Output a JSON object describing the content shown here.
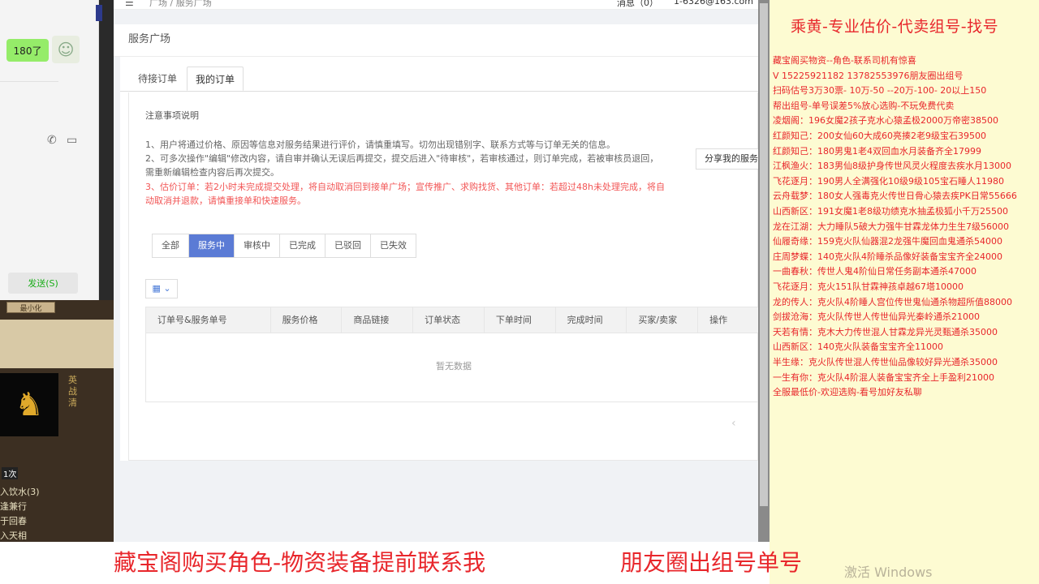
{
  "chat": {
    "bubble_text": "180了",
    "send_label": "发送(S)",
    "sticker_icon": "cat-sticker-icon",
    "phone_icon": "phone-icon",
    "video_icon": "video-icon"
  },
  "game": {
    "top_button": "最小化",
    "count": "1次",
    "lines": [
      "入饮水(3)",
      "逢兼行",
      "于回春",
      "入天相"
    ]
  },
  "web": {
    "breadcrumb": "广场 / 服务广场",
    "messages": "消息（0）",
    "email": "1-6326@163.com",
    "heading": "服务广场",
    "tabs": [
      "待接订单",
      "我的订单"
    ],
    "notice_title": "注意事项说明",
    "notices": [
      "1、用户将通过价格、原因等信息对服务结果进行评价，请慎重填写。切勿出现错别字、联系方式等与订单无关的信息。",
      "2、可多次操作\"编辑\"修改内容，请自审并确认无误后再提交，提交后进入\"待审核\"，若审核通过，则订单完成，若被审核员退回，需重新编辑检查内容后再次提交。"
    ],
    "red_notice": "3、估价订单：若2小时未完成提交处理，将自动取消回到接单广场；宣传推广、求购找货、其他订单：若超过48h未处理完成，将自动取消并退款，请慎重接单和快速服务。",
    "share_button": "分享我的服务",
    "filters": [
      "全部",
      "服务中",
      "审核中",
      "已完成",
      "已驳回",
      "已失效"
    ],
    "columns": [
      "订单号&服务单号",
      "服务价格",
      "商品链接",
      "订单状态",
      "下单时间",
      "完成时间",
      "买家/卖家",
      "操作"
    ],
    "empty": "暂无数据"
  },
  "ads": {
    "title": "乘黄-专业估价-代卖组号-找号",
    "rows": [
      "藏宝阁买物资--角色-联系司机有惊喜",
      "V 15225921182  13782553976朋友圈出组号",
      "扫码估号3万30票- 10万-50 --20万-100- 20以上150",
      "帮出组号-单号误差5%放心选购-不玩免费代卖",
      "凌烟阁：196女魔2孩子克水心猿孟极2000万帝密38500",
      "红颜知己：200女仙60大成60亮揍2老9级宝石39500",
      "红颜知己：180男鬼1老4双回血水月装备齐全17999",
      "江枫渔火：183男仙8级护身传世风灵火程度去疾水月13000",
      "飞花逐月：190男人全满强化10级9级105宝石睡人11980",
      "云舟载梦：180女人强毒克火传世日骨心猿去疾PK日常55666",
      "山西新区：191女魔1老8级功绩克水抽孟极狐小千万25500",
      "龙在江湖：大力睡队5破大力强牛甘霖龙体力生生7级56000",
      "仙履奇缘：159克火队仙器混2龙强牛魔回血鬼通杀54000",
      "庄周梦蝶：140克火队4阶睡杀品像好装备宝宝齐全24000",
      "一曲春秋：传世人鬼4阶仙日常任务副本通杀47000",
      "飞花逐月：克火151队甘霖神孩卓越67塔10000",
      "龙的传人：克火队4阶睡人宫位传世鬼仙通杀物超所值88000",
      "剑拔沧海：克火队传世人传世仙异光秦岭通杀21000",
      "天若有情：克木大力传世混人甘霖龙异光灵甄通杀35000",
      "山西新区：140克火队装备宝宝齐全11000",
      "半生缘：克火队传世混人传世仙品像较好异光通杀35000",
      "一生有你：克火队4阶混人装备宝宝齐全上手盈利21000",
      "全服最低价-欢迎选购-看号加好友私聊"
    ]
  },
  "banner": {
    "left": "藏宝阁购买角色-物资装备提前联系我",
    "right": "朋友圈出组号单号"
  },
  "watermark": "激活 Windows",
  "colors": {
    "accent": "#5b7bd5",
    "ad_red": "#e8262b",
    "ad_bg": "#fdfbd2"
  }
}
